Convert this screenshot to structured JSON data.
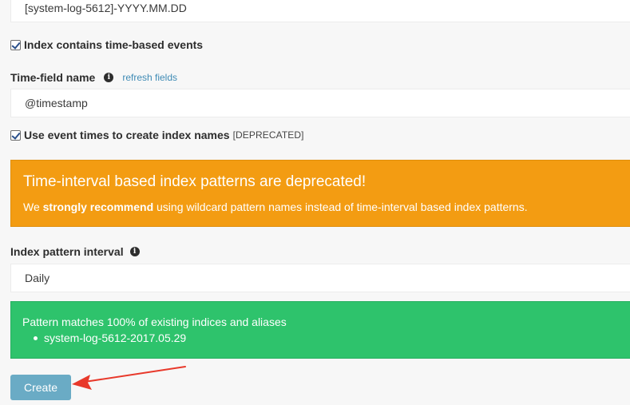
{
  "index_pattern": {
    "value": "[system-log-5612]-YYYY.MM.DD"
  },
  "time_based_events": {
    "checked": true,
    "label": "Index contains time-based events"
  },
  "time_field": {
    "label": "Time-field name",
    "info_icon": "info-circle-icon",
    "refresh_link": "refresh fields",
    "value": "@timestamp"
  },
  "event_times": {
    "checked": true,
    "label": "Use event times to create index names",
    "tag": "[DEPRECATED]"
  },
  "warning": {
    "title": "Time-interval based index patterns are deprecated!",
    "body_prefix": "We ",
    "body_strong": "strongly recommend",
    "body_suffix": " using wildcard pattern names instead of time-interval based index patterns.",
    "color": "#f39c12"
  },
  "interval": {
    "label": "Index pattern interval",
    "info_icon": "info-circle-icon",
    "value": "Daily"
  },
  "match_result": {
    "message": "Pattern matches 100% of existing indices and aliases",
    "items": [
      "system-log-5612-2017.05.29"
    ],
    "color": "#2ec36c"
  },
  "create_button": {
    "label": "Create",
    "color": "#6aabc5"
  },
  "annotation": {
    "arrow_color": "#e8392b",
    "icon": "red-arrow-annotation"
  }
}
